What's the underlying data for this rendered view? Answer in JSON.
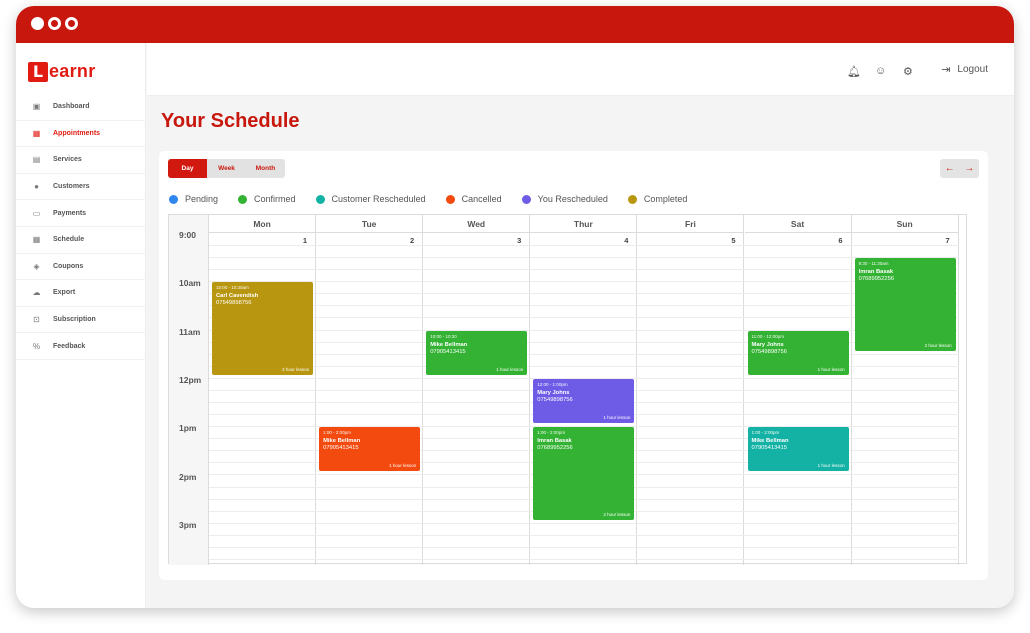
{
  "brand": {
    "logo_letter": "L",
    "logo_rest": "earnr",
    "accent": "#c8170d"
  },
  "sidebar": {
    "items": [
      {
        "label": "Dashboard",
        "icon": "dashboard-icon",
        "glyph": "▣"
      },
      {
        "label": "Appointments",
        "icon": "calendar-check-icon",
        "glyph": "▦",
        "active": true
      },
      {
        "label": "Services",
        "icon": "services-icon",
        "glyph": "▤"
      },
      {
        "label": "Customers",
        "icon": "users-icon",
        "glyph": "●"
      },
      {
        "label": "Payments",
        "icon": "payment-icon",
        "glyph": "▭"
      },
      {
        "label": "Schedule",
        "icon": "calendar-icon",
        "glyph": "▦"
      },
      {
        "label": "Coupons",
        "icon": "coupon-icon",
        "glyph": "◈"
      },
      {
        "label": "Export",
        "icon": "cloud-upload-icon",
        "glyph": "☁"
      },
      {
        "label": "Subscription",
        "icon": "lock-icon",
        "glyph": "⊡"
      },
      {
        "label": "Feedback",
        "icon": "percent-icon",
        "glyph": "%"
      }
    ]
  },
  "topbar": {
    "logout_label": "Logout"
  },
  "page": {
    "title": "Your Schedule"
  },
  "view_switch": {
    "day": "Day",
    "week": "Week",
    "month": "Month"
  },
  "legend": [
    {
      "label": "Pending",
      "color": "#2f86ee"
    },
    {
      "label": "Confirmed",
      "color": "#33b233"
    },
    {
      "label": "Customer Rescheduled",
      "color": "#14b2a4"
    },
    {
      "label": "Cancelled",
      "color": "#f24a0f"
    },
    {
      "label": "You Rescheduled",
      "color": "#6e5be6"
    },
    {
      "label": "Completed",
      "color": "#b8960f"
    }
  ],
  "calendar": {
    "times": [
      "9:00",
      "10am",
      "11am",
      "12pm",
      "1pm",
      "2pm",
      "3pm"
    ],
    "days": [
      {
        "name": "Mon",
        "date": "1"
      },
      {
        "name": "Tue",
        "date": "2"
      },
      {
        "name": "Wed",
        "date": "3"
      },
      {
        "name": "Thur",
        "date": "4"
      },
      {
        "name": "Fri",
        "date": "5"
      },
      {
        "name": "Sat",
        "date": "6"
      },
      {
        "name": "Sun",
        "date": "7"
      }
    ],
    "events": [
      {
        "day": 0,
        "start": 10.083,
        "end": 12.0,
        "time": "10:00 - 10:30am",
        "name": "Carl Cavendish",
        "phone": "07549898756",
        "length": "2 hour lesson",
        "color": "#b8960f"
      },
      {
        "day": 2,
        "start": 11.083,
        "end": 12.0,
        "time": "10:00 - 10:30",
        "name": "Mike Bellman",
        "phone": "07905413415",
        "length": "1 hour lesson",
        "color": "#33b233"
      },
      {
        "day": 5,
        "start": 11.083,
        "end": 12.0,
        "time": "11:00 - 12:00pm",
        "name": "Mary Johns",
        "phone": "07549898756",
        "length": "1 hour lesson",
        "color": "#33b233"
      },
      {
        "day": 6,
        "start": 9.583,
        "end": 11.5,
        "time": "9:30 - 11:30am",
        "name": "Imran Basak",
        "phone": "07689952256",
        "length": "2 hour lesson",
        "color": "#33b233"
      },
      {
        "day": 3,
        "start": 12.083,
        "end": 13.0,
        "time": "12:00 - 1:00pm",
        "name": "Mary Johns",
        "phone": "07549898756",
        "length": "1 hour lesson",
        "color": "#6e5be6"
      },
      {
        "day": 1,
        "start": 13.083,
        "end": 14.0,
        "time": "1:00 - 2:00pm",
        "name": "Mike Bellman",
        "phone": "07905413415",
        "length": "1 hour lesson",
        "color": "#f24a0f"
      },
      {
        "day": 3,
        "start": 13.083,
        "end": 15.0,
        "time": "1:00 - 2:00pm",
        "name": "Imran Basak",
        "phone": "07689952256",
        "length": "2 hour lesson",
        "color": "#33b233"
      },
      {
        "day": 5,
        "start": 13.083,
        "end": 14.0,
        "time": "1:00 - 2:00pm",
        "name": "Mike Bellman",
        "phone": "07905413415",
        "length": "1 hour lesson",
        "color": "#14b2a4"
      }
    ]
  }
}
